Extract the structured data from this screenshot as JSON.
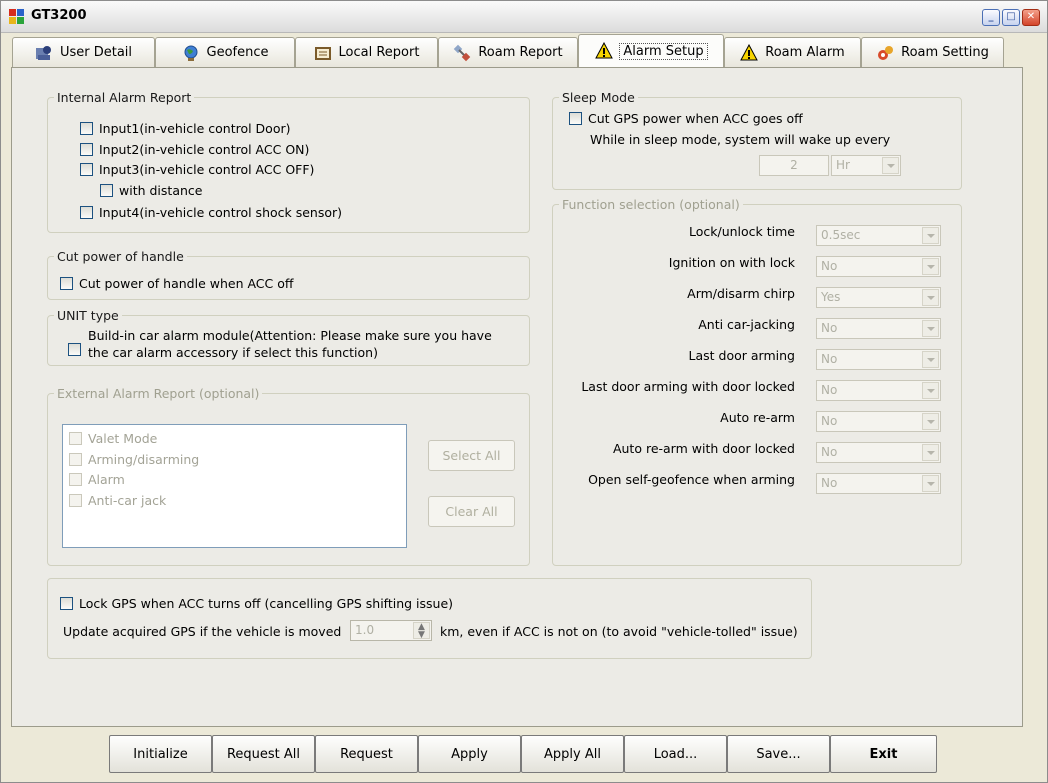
{
  "window": {
    "title": "GT3200"
  },
  "tabs": [
    {
      "label": "User Detail",
      "icon": "user-detail-icon"
    },
    {
      "label": "Geofence",
      "icon": "globe-icon"
    },
    {
      "label": "Local Report",
      "icon": "report-book-icon"
    },
    {
      "label": "Roam Report",
      "icon": "satellite-icon"
    },
    {
      "label": "Alarm Setup",
      "icon": "warning-icon",
      "active": true
    },
    {
      "label": "Roam Alarm",
      "icon": "warning-icon"
    },
    {
      "label": "Roam Setting",
      "icon": "settings-icon"
    }
  ],
  "internal_alarm": {
    "legend": "Internal Alarm Report",
    "items": [
      "Input1(in-vehicle control Door)",
      "Input2(in-vehicle control ACC ON)",
      "Input3(in-vehicle control ACC OFF)",
      "with distance",
      "Input4(in-vehicle control shock sensor)"
    ]
  },
  "cut_power": {
    "legend": "Cut power of handle",
    "item": "Cut power of handle when ACC off"
  },
  "unit_type": {
    "legend": "UNIT type",
    "line1": "Build-in car alarm module(Attention: Please make sure you have",
    "line2": "the car alarm accessory if select this function)"
  },
  "external_alarm": {
    "legend": "External Alarm Report (optional)",
    "items": [
      "Valet Mode",
      "Arming/disarming",
      "Alarm",
      "Anti-car jack"
    ],
    "select_all": "Select All",
    "clear_all": "Clear All"
  },
  "sleep_mode": {
    "legend": "Sleep Mode",
    "item": "Cut GPS power when ACC goes off",
    "wake_text": "While in sleep mode, system will wake up every",
    "interval_value": "2",
    "interval_unit": "Hr"
  },
  "function_selection": {
    "legend": "Function selection (optional)",
    "rows": [
      {
        "label": "Lock/unlock time",
        "value": "0.5sec"
      },
      {
        "label": "Ignition on with lock",
        "value": "No"
      },
      {
        "label": "Arm/disarm chirp",
        "value": "Yes"
      },
      {
        "label": "Anti car-jacking",
        "value": "No"
      },
      {
        "label": "Last door arming",
        "value": "No"
      },
      {
        "label": "Last door arming with door locked",
        "value": "No"
      },
      {
        "label": "Auto re-arm",
        "value": "No"
      },
      {
        "label": "Auto re-arm with door locked",
        "value": "No"
      },
      {
        "label": "Open self-geofence when arming",
        "value": "No"
      }
    ]
  },
  "gps_lock": {
    "item": "Lock GPS when ACC turns off (cancelling GPS shifting issue)",
    "update_prefix": "Update acquired GPS if the vehicle is moved",
    "distance_value": "1.0",
    "update_suffix": "km, even if ACC is not on (to avoid \"vehicle-tolled\" issue)"
  },
  "bottom_buttons": [
    "Initialize",
    "Request All",
    "Request",
    "Apply",
    "Apply All",
    "Load...",
    "Save...",
    "Exit"
  ]
}
